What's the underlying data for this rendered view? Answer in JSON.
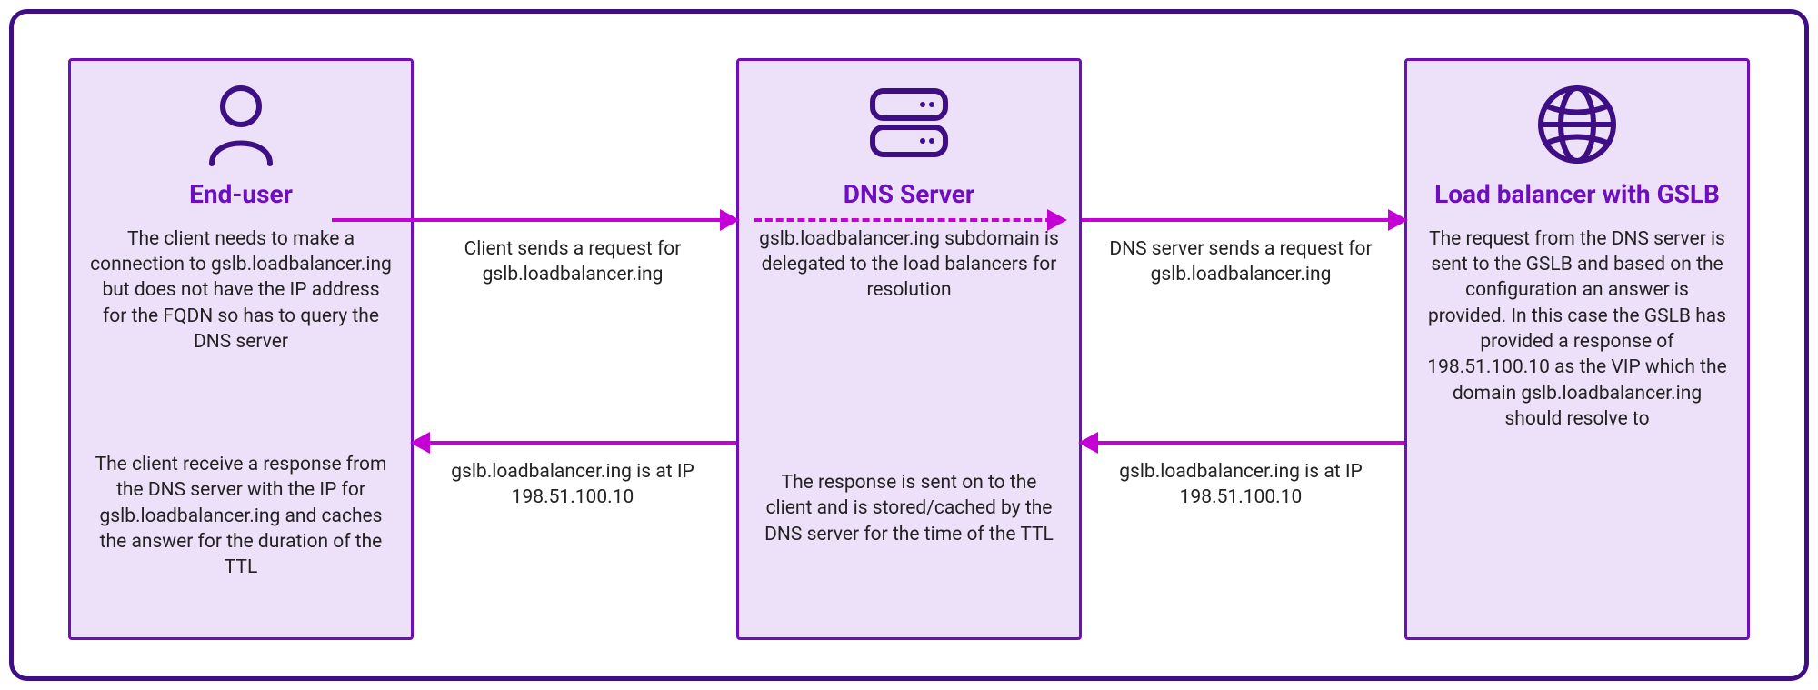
{
  "boxes": {
    "end_user": {
      "title": "End-user",
      "desc1": "The client needs to make a connection to gslb.loadbalancer.ing but does not have the IP address for the FQDN so has to query the DNS server",
      "desc2": "The client receive a response from the DNS server with the IP for gslb.loadbalancer.ing and caches the answer for the duration of the TTL"
    },
    "dns": {
      "title": "DNS Server",
      "desc1": "gslb.loadbalancer.ing subdomain is delegated to the load balancers for resolution",
      "desc2": "The response is sent on to the client and is stored/cached by the DNS server for the time of the TTL"
    },
    "lb": {
      "title": "Load balancer with GSLB",
      "desc1": "The request from the DNS server is sent to the GSLB and based on the configuration an answer is provided. In this case the GSLB has provided a response of 198.51.100.10 as the VIP which the domain gslb.loadbalancer.ing should resolve to"
    }
  },
  "arrows": {
    "top_left": "Client sends a request for gslb.loadbalancer.ing",
    "top_right": "DNS server sends a request for gslb.loadbalancer.ing",
    "bot_left": "gslb.loadbalancer.ing is at IP 198.51.100.10",
    "bot_right": "gslb.loadbalancer.ing is at IP 198.51.100.10"
  }
}
